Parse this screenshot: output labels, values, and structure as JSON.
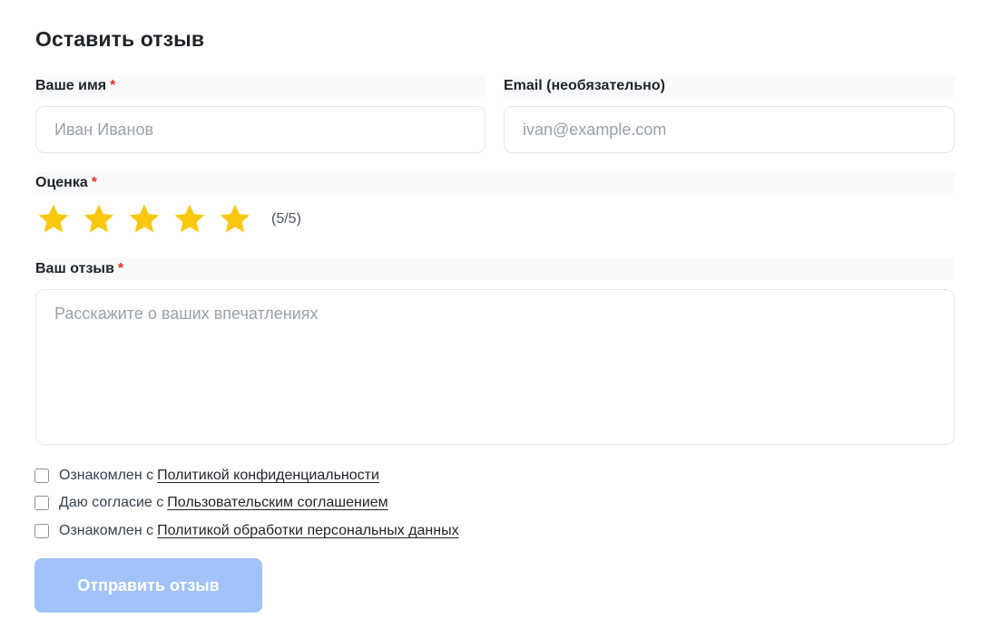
{
  "form": {
    "title": "Оставить отзыв",
    "name": {
      "label": "Ваше имя",
      "required_mark": "*",
      "placeholder": "Иван Иванов",
      "value": ""
    },
    "email": {
      "label": "Email (необязательно)",
      "placeholder": "ivan@example.com",
      "value": ""
    },
    "rating": {
      "label": "Оценка",
      "required_mark": "*",
      "value": 5,
      "max": 5,
      "score_text": "(5/5)",
      "star_color": "#f9c80e"
    },
    "review": {
      "label": "Ваш отзыв",
      "required_mark": "*",
      "placeholder": "Расскажите о ваших впечатлениях",
      "value": ""
    },
    "consents": [
      {
        "prefix": "Ознакомлен с",
        "link": "Политикой конфиденциальности",
        "checked": false
      },
      {
        "prefix": "Даю согласие с",
        "link": "Пользовательским соглашением",
        "checked": false
      },
      {
        "prefix": "Ознакомлен с",
        "link": "Политикой обработки персональных данных",
        "checked": false
      }
    ],
    "submit_label": "Отправить отзыв",
    "submit_color": "#a2c2fa"
  }
}
